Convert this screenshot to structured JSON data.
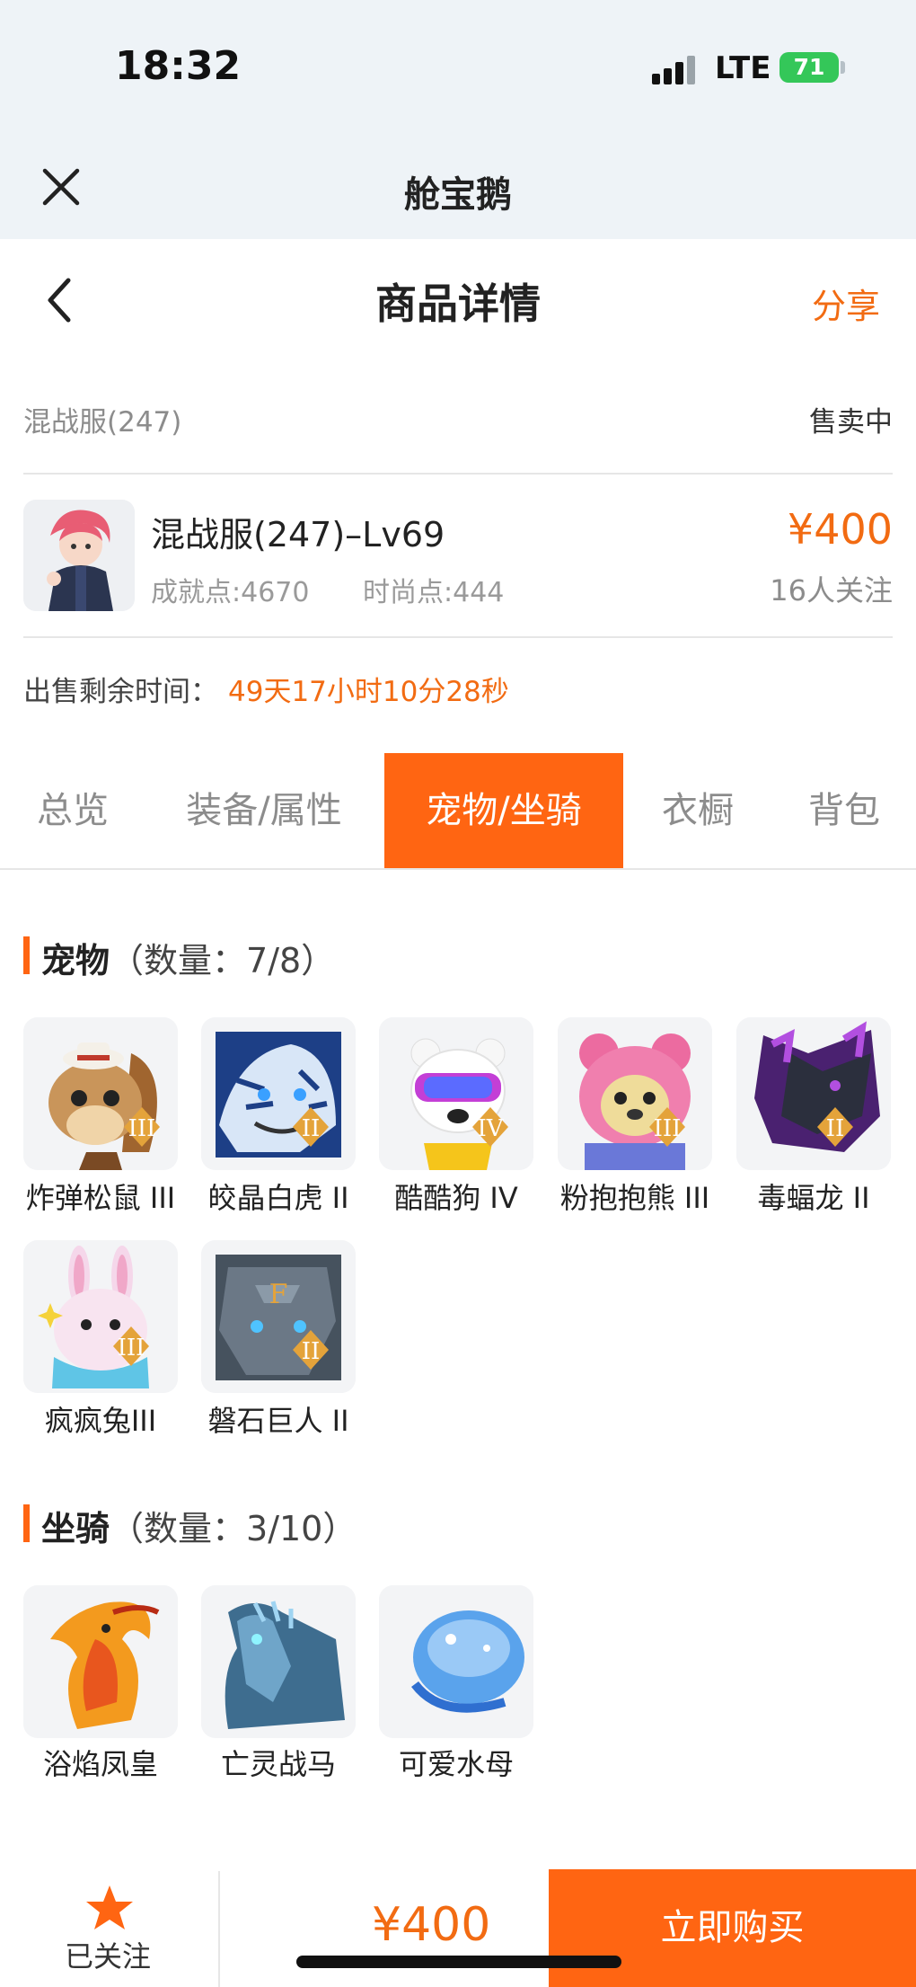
{
  "status_bar": {
    "time": "18:32",
    "network": "LTE",
    "battery": "71"
  },
  "app_bar": {
    "title": "舱宝鹅"
  },
  "header": {
    "title": "商品详情",
    "share": "分享"
  },
  "listing": {
    "server": "混战服(247)",
    "status": "售卖中",
    "title": "混战服(247)–Lv69",
    "achievement": "成就点:4670",
    "fashion": "时尚点:444",
    "price": "¥400",
    "followers": "16人关注",
    "remaining_label": "出售剩余时间：",
    "remaining_value": "49天17小时10分28秒"
  },
  "tabs": [
    {
      "label": "总览",
      "active": false
    },
    {
      "label": "装备/属性",
      "active": false
    },
    {
      "label": "宠物/坐骑",
      "active": true
    },
    {
      "label": "衣橱",
      "active": false
    },
    {
      "label": "背包",
      "active": false
    }
  ],
  "pets": {
    "title": "宠物",
    "count": "（数量：7/8）",
    "items": [
      {
        "name": "炸弹松鼠 III",
        "rank": "III",
        "icon": "squirrel-icon"
      },
      {
        "name": "皎晶白虎 II",
        "rank": "II",
        "icon": "white-tiger-icon"
      },
      {
        "name": "酷酷狗 IV",
        "rank": "IV",
        "icon": "dog-icon"
      },
      {
        "name": "粉抱抱熊 III",
        "rank": "III",
        "icon": "pink-bear-icon"
      },
      {
        "name": "毒蝠龙 II",
        "rank": "II",
        "icon": "bat-dragon-icon"
      },
      {
        "name": "疯疯兔III",
        "rank": "III",
        "icon": "rabbit-icon"
      },
      {
        "name": "磐石巨人 II",
        "rank": "II",
        "icon": "rock-giant-icon"
      }
    ]
  },
  "mounts": {
    "title": "坐骑",
    "count": "（数量：3/10）",
    "items": [
      {
        "name": "浴焰凤皇",
        "icon": "phoenix-icon"
      },
      {
        "name": "亡灵战马",
        "icon": "undead-horse-icon"
      },
      {
        "name": "可爱水母",
        "icon": "jellyfish-icon"
      }
    ]
  },
  "bottom_bar": {
    "followed": "已关注",
    "price": "¥400",
    "buy": "立即购买"
  },
  "colors": {
    "accent": "#ff6512",
    "price": "#f26b12",
    "app_bg": "#eef3f7"
  }
}
